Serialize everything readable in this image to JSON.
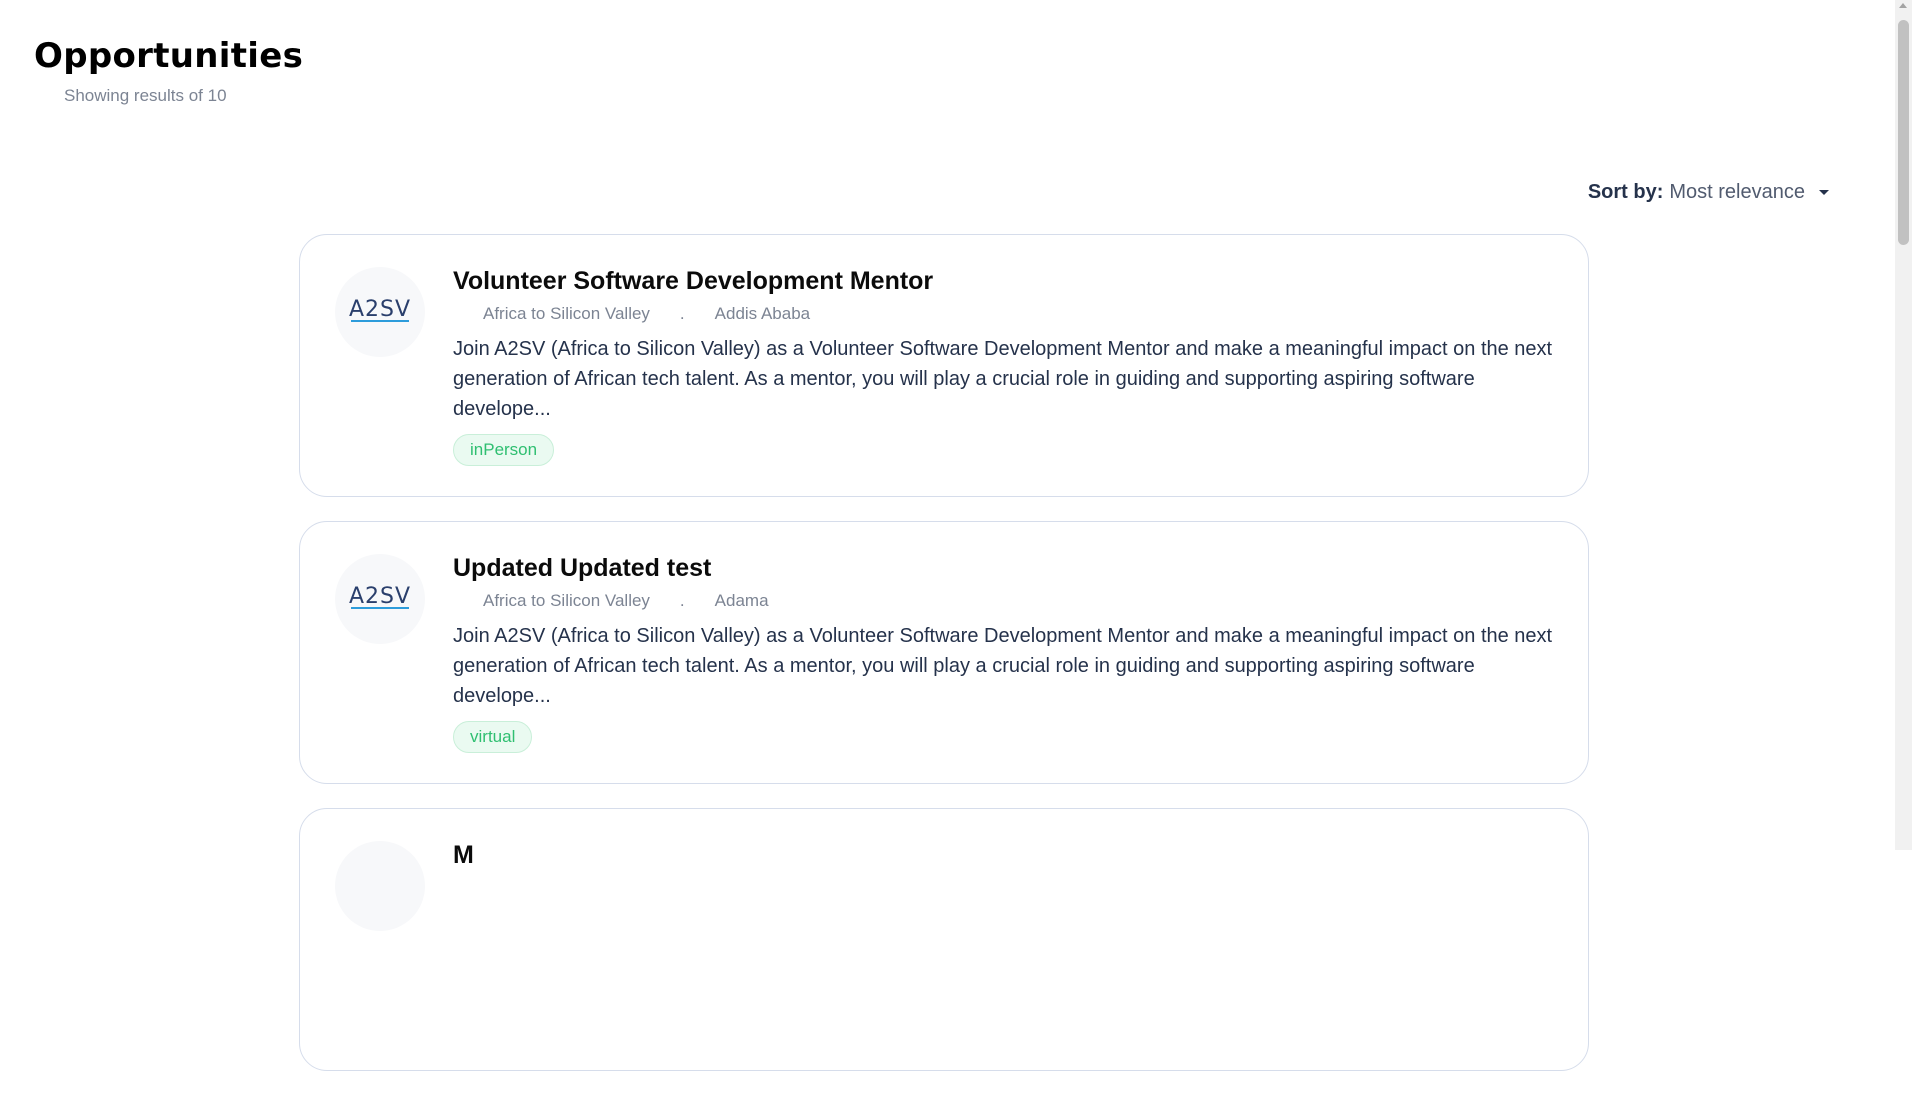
{
  "header": {
    "title": "Opportunities",
    "results_text": "Showing results of 10"
  },
  "sort": {
    "label": "Sort by:",
    "value": "Most relevance"
  },
  "colors": {
    "title": "#000000",
    "muted": "#7C8493",
    "tag_green": "#2fbf71",
    "logo_dark": "#2a3f6c",
    "logo_light": "#2d9cdb"
  },
  "opportunities": [
    {
      "title": "Volunteer Software Development Mentor",
      "org": "Africa to Silicon Valley",
      "separator": ".",
      "location": "Addis Ababa",
      "description": "Join A2SV (Africa to Silicon Valley) as a Volunteer Software Development Mentor and make a meaningful impact on the next generation of African tech talent. As a mentor, you will play a crucial role in guiding and supporting aspiring software develope...",
      "tag": "inPerson",
      "logo_text": "A2SV"
    },
    {
      "title": "Updated Updated test",
      "org": "Africa to Silicon Valley",
      "separator": ".",
      "location": "Adama",
      "description": "Join A2SV (Africa to Silicon Valley) as a Volunteer Software Development Mentor and make a meaningful impact on the next generation of African tech talent. As a mentor, you will play a crucial role in guiding and supporting aspiring software develope...",
      "tag": "virtual",
      "logo_text": "A2SV"
    },
    {
      "title": "M",
      "logo_text": ""
    }
  ]
}
